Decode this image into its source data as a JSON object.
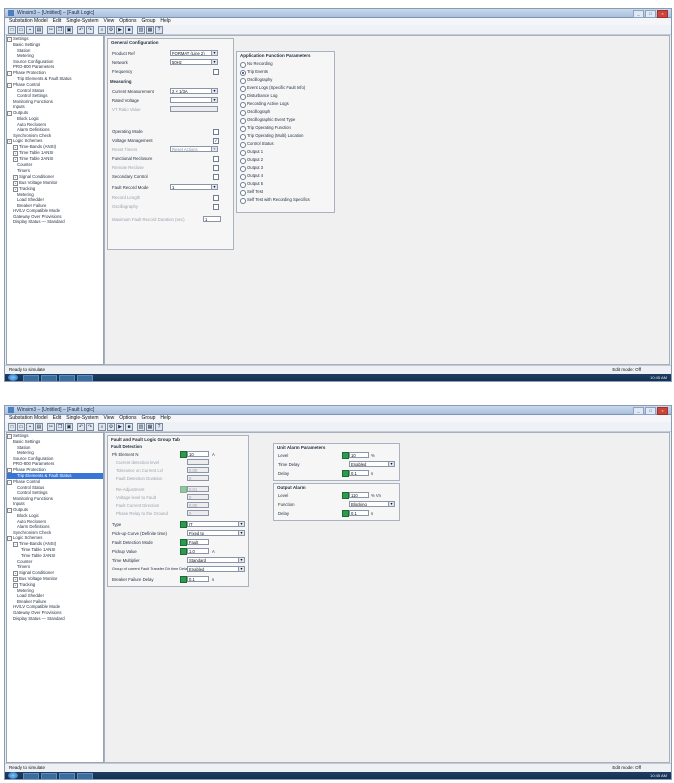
{
  "window": {
    "title": "Winsim3 – [Untitled] – [Fault Logic]",
    "menus": [
      "Substation Model",
      "Edit",
      "Single-System",
      "View",
      "Options",
      "Group",
      "Help"
    ]
  },
  "tree": {
    "items": [
      "Settings",
      "Basic Settings",
      "Station",
      "Metering",
      "Source Configuration",
      "PRO-800 Parameters",
      "Phase Protection",
      "Trip Elements & Fault Status",
      "Phase Control",
      "Control Status",
      "Control Settings",
      "Monitoring Functions",
      "Inputs",
      "Outputs",
      "Block Logic",
      "Auto Reclosers",
      "Alarm Definitions",
      "Synchronism Check",
      "Logic Schemes",
      "Time-Bands (ANSI)",
      "Time Table 1ANSI",
      "Time Table 2ANSI",
      "Counter",
      "Timers",
      "Signal Conditioner",
      "Bus Voltage Monitor",
      "Tracking",
      "Metering",
      "Load Shedder",
      "Breaker Failure",
      "HV/LV Compatible Mode",
      "Gateway Over Provisions",
      "Display Status — Standard"
    ],
    "selected_index": 7
  },
  "screen1": {
    "general": {
      "title": "General Configuration",
      "rows": [
        {
          "label": "Product Ref",
          "value": "FORMAT (Line 2)",
          "kind": "combo"
        },
        {
          "label": "Network",
          "value": "50Hz",
          "kind": "combo"
        },
        {
          "label": "Frequency",
          "value": "",
          "kind": "check"
        }
      ],
      "section_title": "Measuring",
      "rows2": [
        {
          "label": "Current Measurement",
          "value": "2 × 1/3A",
          "kind": "combo"
        },
        {
          "label": "Rated Voltage",
          "value": "",
          "kind": "combo"
        },
        {
          "label": "VT Ratio Value",
          "value": "",
          "kind": "field"
        }
      ],
      "rows3": [
        {
          "label": "Operating Mode",
          "checked": false
        },
        {
          "label": "Voltage Management",
          "checked": true
        },
        {
          "label": "Reset Timers",
          "value": "Reset Actions",
          "kind": "combo"
        },
        {
          "label": "Functional Reclosure",
          "checked": false
        },
        {
          "label": "Remote Reclose",
          "checked": false
        },
        {
          "label": "Secondary Control",
          "checked": false
        },
        {
          "label": "Fault Record Mode",
          "value": "1",
          "kind": "combo"
        },
        {
          "label": "Record Length",
          "checked": false
        },
        {
          "label": "Oscillography",
          "checked": false
        }
      ],
      "bottom_label": "Maximum Fault Record Duration (sec)",
      "bottom_value": "1"
    },
    "options": {
      "title": "Application Function Parameters",
      "items": [
        "No Recording",
        "Trip Events",
        "Oscillography",
        "Event Logs (Specific Fault Info)",
        "Disturbance Log",
        "Recording Active Logs",
        "Oscillograph",
        "Oscillographic Event Type",
        "Trip Operating Function",
        "Trip Operating (Multi) Location",
        "Control Status",
        "Output 1",
        "Output 2",
        "Output 3",
        "Output 4",
        "Output 5",
        "Self Test",
        "Self Test with Recording Specifics"
      ],
      "checked_index": 1
    }
  },
  "screen2": {
    "fault_logic": {
      "title": "Fault and Fault Logic Group Tab",
      "section": "Fault Detection",
      "rows": [
        {
          "label": "Ph Element N",
          "value": "10",
          "unit": "A",
          "dim": false
        },
        {
          "label": "Current detection level",
          "value": "",
          "unit": "",
          "dim": true
        },
        {
          "label": "Tolerance on Current Lvl",
          "value": "0.00",
          "unit": "",
          "dim": true
        },
        {
          "label": "Fault Detection Duration",
          "value": "0",
          "unit": "",
          "dim": true
        },
        {
          "label": "Re-Adjustment",
          "value": "0.01",
          "unit": "",
          "dim": true
        },
        {
          "label": "Voltage level to Fault",
          "value": "0",
          "unit": "",
          "dim": true
        },
        {
          "label": "Fault Current Direction",
          "value": "0.00",
          "unit": "",
          "dim": true
        },
        {
          "label": "Phase Relay to the Ground",
          "value": "0",
          "unit": "",
          "dim": true
        }
      ],
      "combos": [
        {
          "label": "Type",
          "value": "IT"
        },
        {
          "label": "Pick-up Curve (Definite time)",
          "value": "Fixed tp"
        },
        {
          "label": "Fault Detection Mode",
          "value": "Fault"
        },
        {
          "label": "Pickup Value",
          "value": "1.0",
          "unit": "A"
        },
        {
          "label": "Time Multiplier",
          "value": "Standard"
        },
        {
          "label": "Group of current Fault Transfer Dir time Delay",
          "value": "Enabled"
        },
        {
          "label": "Breaker Failure Delay",
          "value": "0.1",
          "unit": "s"
        }
      ]
    },
    "right_top": {
      "title": "Unit Alarm Parameters",
      "rows": [
        {
          "label": "Level",
          "value": "10",
          "unit": "%"
        },
        {
          "label": "Time Delay",
          "value": "Enabled"
        },
        {
          "label": "Delay",
          "value": "0.1",
          "unit": "s"
        }
      ]
    },
    "right_bottom": {
      "title": "Output Alarm",
      "rows": [
        {
          "label": "Level",
          "value": "110",
          "unit": "% Vn"
        },
        {
          "label": "Function",
          "value": "Blocking"
        },
        {
          "label": "Delay",
          "value": "0.1",
          "unit": "s"
        }
      ]
    }
  },
  "status": {
    "left": "Ready to simulate",
    "right": "Edit mode: Off",
    "clock": "10:45 AM"
  }
}
